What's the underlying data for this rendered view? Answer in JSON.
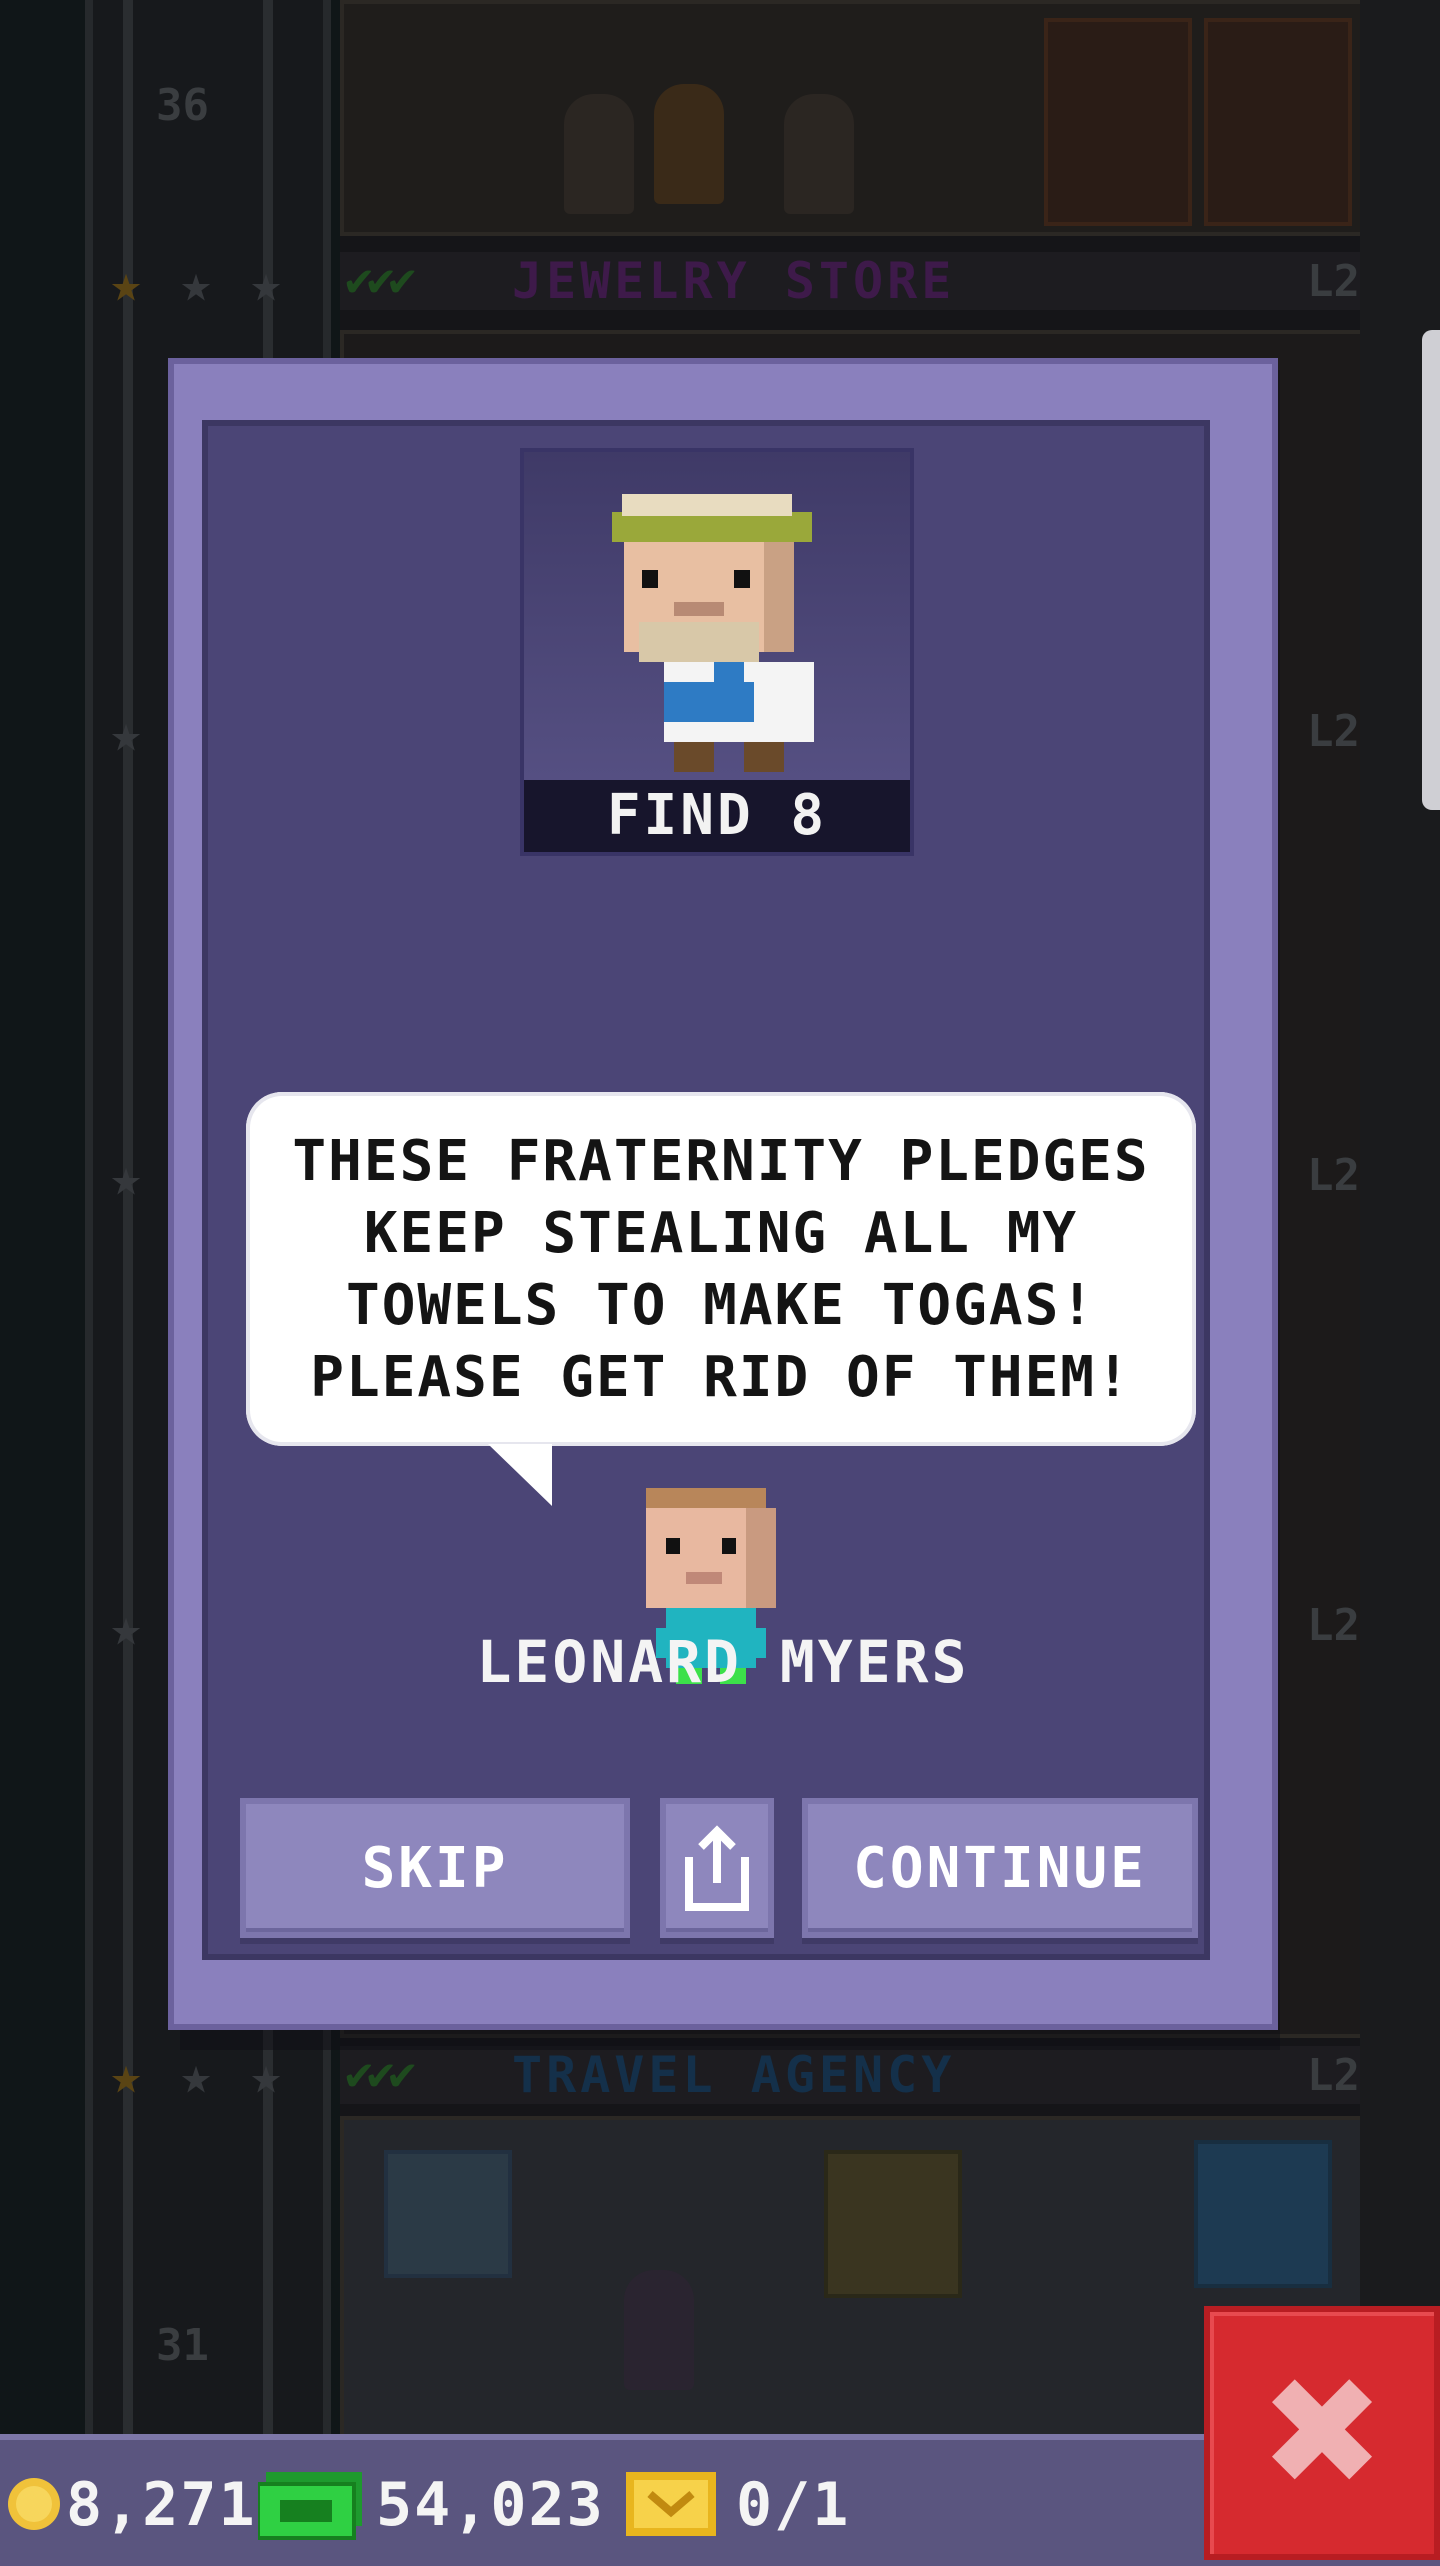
{
  "background": {
    "floors": [
      {
        "number": "36",
        "name": "JEWELRY STORE",
        "level": "L2",
        "checks": "✔✔✔"
      },
      {
        "number": "31",
        "name": "TRAVEL AGENCY",
        "level": "L2",
        "checks": "✔✔✔"
      }
    ],
    "side_levels": [
      "L2",
      "L2",
      "L2"
    ]
  },
  "quest": {
    "find_label": "FIND 8",
    "message_lines": [
      "THESE FRATERNITY PLEDGES",
      "KEEP STEALING ALL MY",
      "TOWELS TO MAKE TOGAS!",
      "PLEASE GET RID OF THEM!"
    ],
    "giver_name": "LEONARD MYERS"
  },
  "buttons": {
    "skip": "SKIP",
    "continue": "CONTINUE",
    "share_icon": "share-icon"
  },
  "hud": {
    "coins": "8,271",
    "bux": "54,023",
    "tickets": "0/1",
    "close_icon": "close-icon"
  },
  "colors": {
    "modal_outer": "#8a80bd",
    "modal_inner": "#4b4576",
    "button": "#8e87bd",
    "close": "#d62a2f",
    "hud": "#5a557f"
  }
}
